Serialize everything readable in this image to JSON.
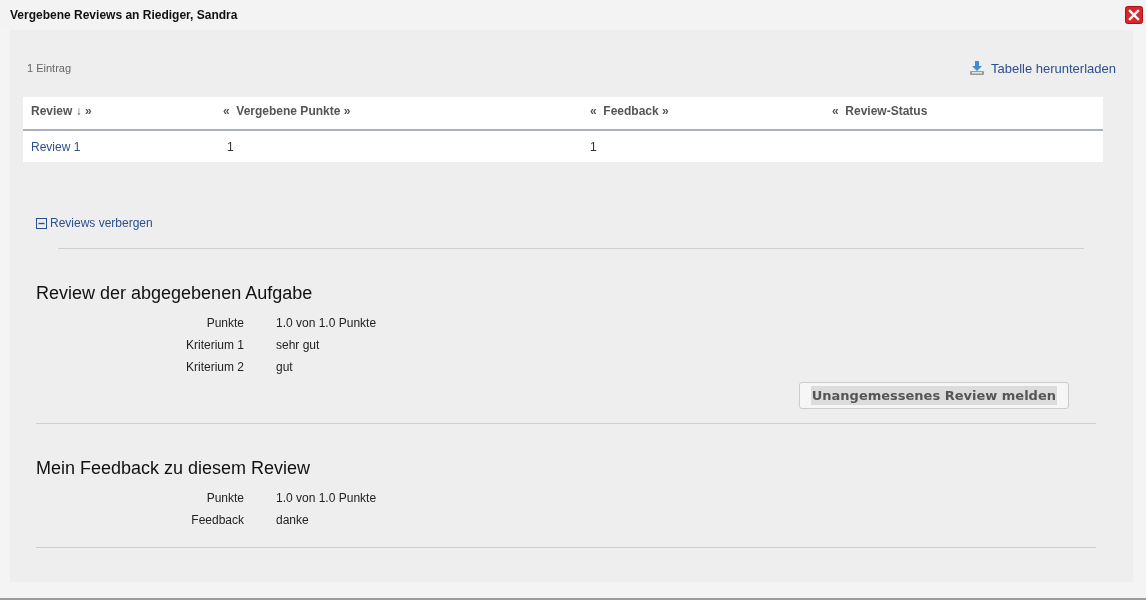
{
  "dialog": {
    "title": "Vergebene Reviews an Riediger, Sandra"
  },
  "toolbar": {
    "count": "1 Eintrag",
    "download_link": "Tabelle herunterladen"
  },
  "table": {
    "columns": [
      {
        "label": "Review ↓ »"
      },
      {
        "label": "«  Vergebene Punkte »"
      },
      {
        "label": "«  Feedback »"
      },
      {
        "label": "«  Review-Status"
      }
    ],
    "rows": [
      {
        "review": "Review 1",
        "points": "1",
        "feedback": "1"
      }
    ]
  },
  "toggle": {
    "label": "Reviews verbergen",
    "expanded": true
  },
  "sections": [
    {
      "title": "Review der abgegebenen Aufgabe",
      "fields": [
        {
          "label": "Punkte",
          "value": "1.0 von 1.0 Punkte"
        },
        {
          "label": "Kriterium 1",
          "value": "sehr gut"
        },
        {
          "label": "Kriterium 2",
          "value": "gut"
        }
      ],
      "button": "Unangemessenes Review melden"
    },
    {
      "title": "Mein Feedback zu diesem Review",
      "fields": [
        {
          "label": "Punkte",
          "value": "1.0 von 1.0 Punkte"
        },
        {
          "label": "Feedback",
          "value": "danke"
        }
      ]
    }
  ]
}
